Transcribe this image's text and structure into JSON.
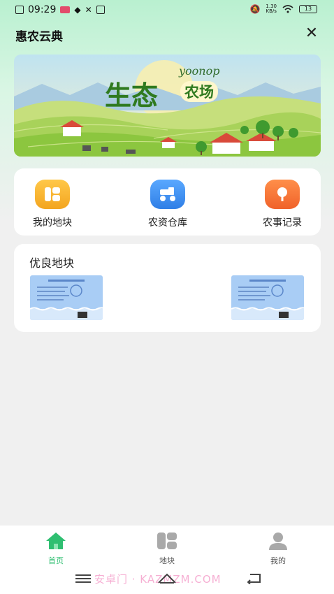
{
  "status_bar": {
    "time": "09:29",
    "net_speed_value": "1.30",
    "net_speed_unit": "KB/s",
    "battery": "13"
  },
  "header": {
    "title": "惠农云典",
    "close_icon": "close-icon"
  },
  "banner": {
    "title_main": "生态",
    "title_sub": "农场",
    "brand": "yoonop"
  },
  "menu": [
    {
      "label": "我的地块",
      "icon": "plot-icon",
      "color": "#f7b52b"
    },
    {
      "label": "农资仓库",
      "icon": "tractor-icon",
      "color": "#3a8ff0"
    },
    {
      "label": "农事记录",
      "icon": "tree-icon",
      "color": "#f5732b"
    }
  ],
  "plots": {
    "title": "优良地块"
  },
  "tabbar": {
    "tabs": [
      {
        "label": "首页",
        "icon": "home-icon",
        "active": true
      },
      {
        "label": "地块",
        "icon": "plots-icon",
        "active": false
      },
      {
        "label": "我的",
        "icon": "user-icon",
        "active": false
      }
    ],
    "active_color": "#2fbf71",
    "inactive_color": "#555555"
  },
  "watermark": "安卓门 · KAZMZM.COM"
}
